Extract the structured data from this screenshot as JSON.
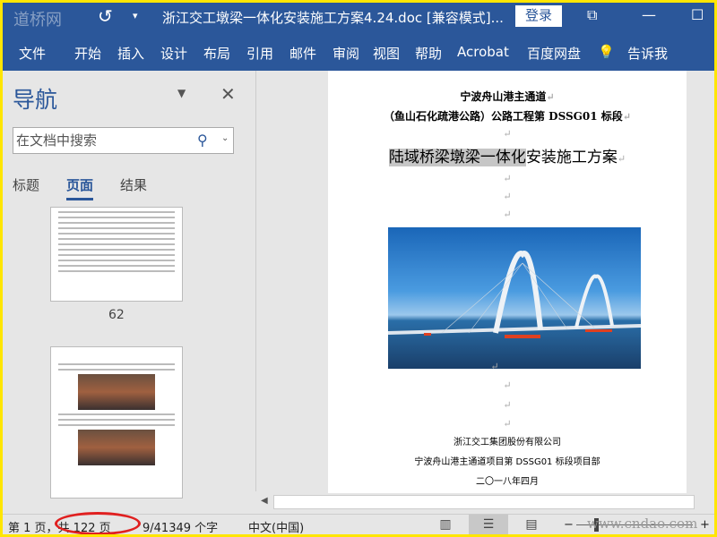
{
  "titlebar": {
    "watermark": "道桥网",
    "title": "浙江交工墩梁一体化安装施工方案4.24.doc [兼容模式]...",
    "login": "登录",
    "undo_icon": "↺",
    "qa": "▾",
    "restore": "⧉",
    "minimize": "—",
    "maximize": "☐"
  },
  "ribbon": {
    "tabs": [
      "文件",
      "开始",
      "插入",
      "设计",
      "布局",
      "引用",
      "邮件",
      "审阅",
      "视图",
      "帮助",
      "Acrobat",
      "百度网盘"
    ],
    "tell_me": "告诉我",
    "bulb": "💡"
  },
  "nav": {
    "title": "导航",
    "search_placeholder": "在文档中搜索",
    "tabs": [
      "标题",
      "页面",
      "结果"
    ],
    "active_tab": "页面",
    "page_numbers": [
      "62"
    ]
  },
  "doc": {
    "line1": "宁波舟山港主通道",
    "line2": "（鱼山石化疏港公路）公路工程第 DSSG01 标段",
    "title_highlight": "陆域桥梁墩梁一体化",
    "title_rest": "安装施工方案",
    "company": "浙江交工集团股份有限公司",
    "dept": "宁波舟山港主通道项目第 DSSG01 标段项目部",
    "date": "二〇一八年四月",
    "para_mark": "↵"
  },
  "status": {
    "page": "第 1 页，共 122 页",
    "words": "9/41349 个字",
    "language": "中文(中国)",
    "watermark": "www.cndao.com",
    "zoom_minus": "−",
    "zoom_plus": "+"
  }
}
